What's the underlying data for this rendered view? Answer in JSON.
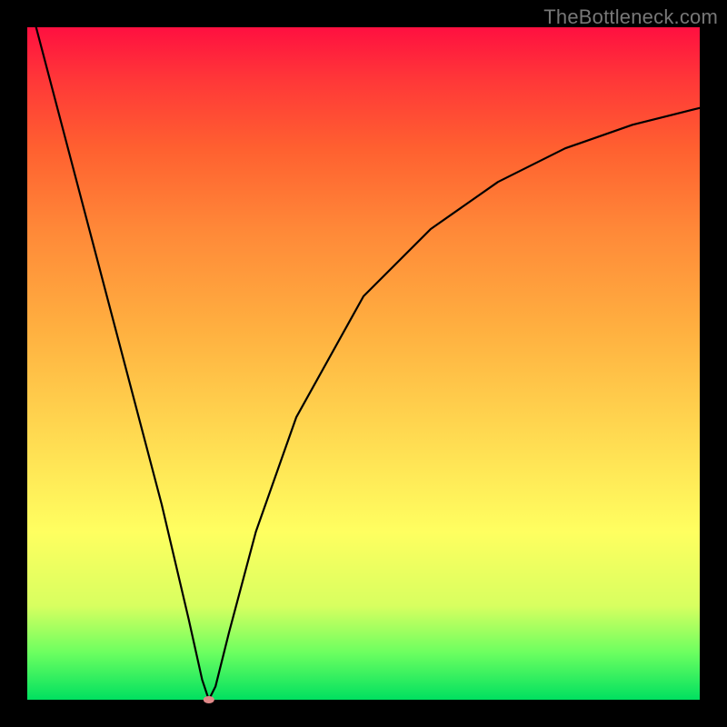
{
  "watermark": "TheBottleneck.com",
  "chart_data": {
    "type": "line",
    "title": "",
    "xlabel": "",
    "ylabel": "",
    "xlim": [
      0,
      100
    ],
    "ylim": [
      0,
      100
    ],
    "grid": false,
    "legend": false,
    "series": [
      {
        "name": "bottleneck-curve",
        "x": [
          0,
          5,
          10,
          15,
          20,
          24,
          26,
          27,
          28,
          30,
          34,
          40,
          50,
          60,
          70,
          80,
          90,
          100
        ],
        "values": [
          105,
          86,
          67,
          48,
          29,
          12,
          3,
          0,
          2,
          10,
          25,
          42,
          60,
          70,
          77,
          82,
          85.5,
          88
        ]
      }
    ],
    "marker": {
      "x": 27,
      "y": 0,
      "rx": 6,
      "ry": 4,
      "color": "#e08888"
    }
  }
}
